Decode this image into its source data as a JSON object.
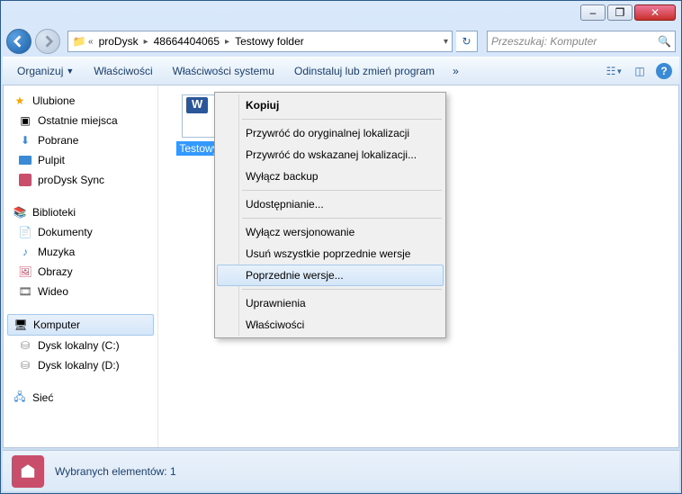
{
  "window_controls": {
    "minimize": "–",
    "maximize": "❐",
    "close": "✕"
  },
  "breadcrumb": {
    "segments": [
      "proDysk",
      "48664404065",
      "Testowy folder"
    ]
  },
  "search": {
    "placeholder": "Przeszukaj: Komputer"
  },
  "toolbar": {
    "items": [
      "Organizuj",
      "Właściwości",
      "Właściwości systemu",
      "Odinstaluj lub zmień program"
    ],
    "more": "»"
  },
  "sidebar": {
    "favorites": {
      "label": "Ulubione",
      "items": [
        "Ostatnie miejsca",
        "Pobrane",
        "Pulpit",
        "proDysk Sync"
      ]
    },
    "libraries": {
      "label": "Biblioteki",
      "items": [
        "Dokumenty",
        "Muzyka",
        "Obrazy",
        "Wideo"
      ]
    },
    "computer": {
      "label": "Komputer",
      "items": [
        "Dysk lokalny (C:)",
        "Dysk lokalny (D:)"
      ]
    },
    "network": {
      "label": "Sieć"
    }
  },
  "content": {
    "selected_file": "Testowy p"
  },
  "context_menu": {
    "items": [
      {
        "label": "Kopiuj",
        "bold": true
      },
      {
        "sep": true
      },
      {
        "label": "Przywróć do oryginalnej lokalizacji"
      },
      {
        "label": "Przywróć do wskazanej lokalizacji..."
      },
      {
        "label": "Wyłącz backup"
      },
      {
        "sep": true
      },
      {
        "label": "Udostępnianie..."
      },
      {
        "sep": true
      },
      {
        "label": "Wyłącz wersjonowanie"
      },
      {
        "label": "Usuń wszystkie poprzednie wersje"
      },
      {
        "label": "Poprzednie wersje...",
        "hover": true
      },
      {
        "sep": true
      },
      {
        "label": "Uprawnienia"
      },
      {
        "label": "Właściwości"
      }
    ]
  },
  "statusbar": {
    "text": "Wybranych elementów: 1"
  }
}
